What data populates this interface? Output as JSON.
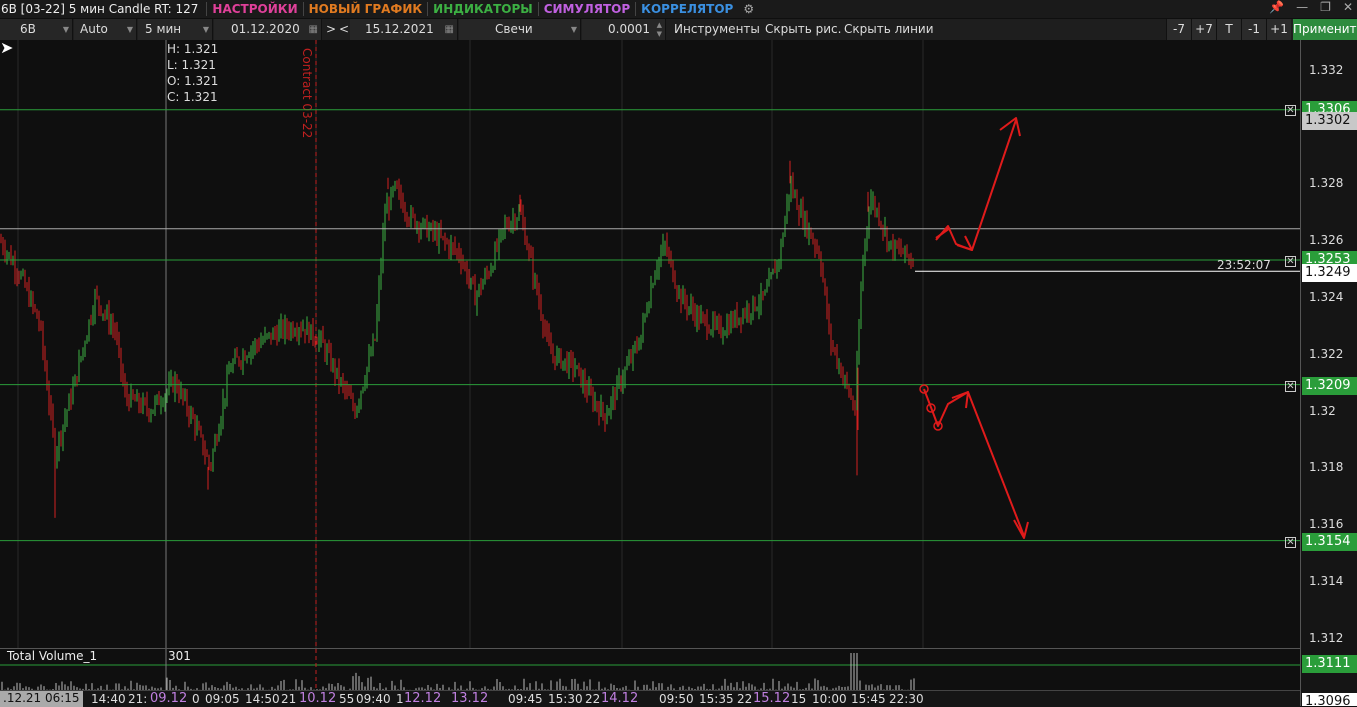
{
  "titlebar": {
    "title": "6B [03-22] 5 мин Candle RT: 127",
    "menus": [
      {
        "label": "НАСТРОЙКИ",
        "color": "#e0409a"
      },
      {
        "label": "НОВЫЙ ГРАФИК",
        "color": "#e07a20"
      },
      {
        "label": "ИНДИКАТОРЫ",
        "color": "#3cb043"
      },
      {
        "label": "СИМУЛЯТОР",
        "color": "#c060e0"
      },
      {
        "label": "КОРРЕЛЯТОР",
        "color": "#3a8fe0"
      }
    ]
  },
  "toolbar": {
    "symbol": "6B",
    "scale": "Auto",
    "timeframe": "5 мин",
    "date_from": "01.12.2020",
    "nav_next": ">",
    "nav_prev": "<",
    "date_to": "15.12.2021",
    "chart_type": "Свечи",
    "step": "0.0001",
    "tools": "Инструменты",
    "hide_drawings": "Скрыть рис.",
    "hide_lines": "Скрыть линии",
    "btn_m7": "-7",
    "btn_p7": "+7",
    "btn_t": "T",
    "btn_m1": "-1",
    "btn_p1": "+1",
    "apply": "Применить"
  },
  "ohlc": {
    "h": "H: 1.321",
    "l": "L: 1.321",
    "o": "O: 1.321",
    "c": "C: 1.321"
  },
  "contract_label": "Contract 03-22",
  "price_axis": {
    "ticks": [
      "1.332",
      "1.328",
      "1.326",
      "1.324",
      "1.322",
      "1.32",
      "1.318",
      "1.316",
      "1.314",
      "1.312"
    ],
    "levels": [
      {
        "price": "1.3306",
        "color": "#2a9d3a"
      },
      {
        "price": "1.3302",
        "color": "#c8c8c8"
      },
      {
        "price": "1.3253",
        "color": "#2a9d3a"
      },
      {
        "price": "1.3249",
        "color": "#ffffff"
      },
      {
        "price": "1.3209",
        "color": "#2a9d3a"
      },
      {
        "price": "1.3154",
        "color": "#2a9d3a"
      },
      {
        "price": "1.3111",
        "color": "#2a9d3a"
      },
      {
        "price": "1.3096",
        "color": "#ffffff"
      }
    ]
  },
  "timer": "23:52:07",
  "volume": {
    "label": "Total Volume_1",
    "value": "301"
  },
  "time_axis": {
    "current": ".12.21 06:15",
    "labels": [
      "14:40",
      "21:",
      "09.12",
      "0",
      "09:05",
      "14:50",
      "21",
      "10.12",
      "55",
      "09:40",
      "1",
      "12.12",
      "13.12",
      "09:45",
      "15:30",
      "22",
      "14.12",
      "09:50",
      "15:35",
      "22",
      "15.12",
      "15",
      "10:00",
      "15:45",
      "22:30"
    ]
  },
  "colors": {
    "bull": "#3cb043",
    "bear": "#d02020",
    "level": "#2a9d3a",
    "arrow": "#e01b1b"
  }
}
